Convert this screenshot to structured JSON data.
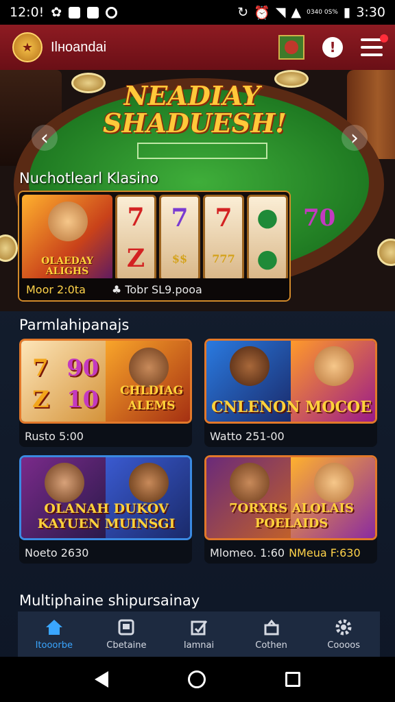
{
  "status_bar": {
    "time_left": "12:0!",
    "carrier_mini": "0340\n0S%",
    "time_right": "3:30"
  },
  "header": {
    "logo_text": "★",
    "app_title": "Ilноandai"
  },
  "hero": {
    "title": "NEADIAY SHADUESH!",
    "subtitle": "Nuchotlearl Klasino",
    "feature_card_label": "OLAEDAY ALIGHS",
    "reel_1": [
      "7",
      "Z"
    ],
    "reel_2": [
      "7",
      "$$"
    ],
    "reel_3": [
      "7",
      "777"
    ],
    "reel_4": [
      "●",
      "●"
    ],
    "side_value": "70",
    "foot_left": "Moor 2:0ta",
    "foot_right": "Tobr SL9.pooa"
  },
  "section_1": {
    "title": "Parmlahipanajs"
  },
  "games": [
    {
      "title": "CHLDIAG ALEMS",
      "footer": "Rusto 5:00",
      "accent": ""
    },
    {
      "title": "CNLENON  MOCOE",
      "footer": "Watto 251-00",
      "accent": ""
    },
    {
      "title": "OLANAH  DUKOV KAYUEN  MUINSGI",
      "footer": "Noeto 2630",
      "accent": ""
    },
    {
      "title": "7ORXRS  ALOLAIS  POELAIDS",
      "footer": "Mlomeo. 1:60",
      "accent": "NMeua F:630"
    }
  ],
  "section_2": {
    "title": "Multiphaine shipursainay"
  },
  "bottom_nav": [
    {
      "label": "Itooorbe",
      "icon": "home-icon"
    },
    {
      "label": "Cbetaine",
      "icon": "wallet-icon"
    },
    {
      "label": "Iamnai",
      "icon": "edit-icon"
    },
    {
      "label": "Cothen",
      "icon": "store-icon"
    },
    {
      "label": "Coooos",
      "icon": "gear-icon"
    }
  ],
  "colors": {
    "appbar": "#8e1b22",
    "accent_gold": "#ffd23a",
    "active_nav": "#3aa6ff"
  }
}
